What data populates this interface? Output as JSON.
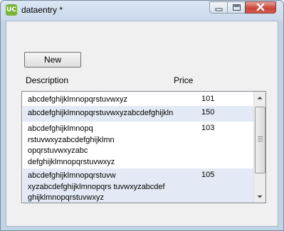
{
  "window": {
    "title": "dataentry *",
    "app_icon": "uc-app-icon",
    "controls": [
      "minimize-icon",
      "maximize-icon",
      "close-icon"
    ]
  },
  "toolbar": {
    "new_label": "New"
  },
  "headers": {
    "description": "Description",
    "price": "Price"
  },
  "rows": [
    {
      "description": "abcdefghijklmnopqrstuvwxyz",
      "price": "101"
    },
    {
      "description": "abcdefghijklmnopqrstuvwxyzabcdefghijkln",
      "price": "150"
    },
    {
      "description": "abcdefghijklmnopq\nrstuvwxyzabcdefghijklmn\nopqrstuvwxyzabc\ndefghijklmnopqrstuvwxyz",
      "price": "103"
    },
    {
      "description": "abcdefghijklmnopqrstuvw\nxyzabcdefghijklmnopqrs tuvwxyzabcdef\nghijklmnopqrstuvwxyz",
      "price": "105"
    }
  ],
  "colors": {
    "alt_row": "#e3eaf5",
    "window_frame": "#cad9eb",
    "close_button": "#c9453a",
    "app_icon": "#7bb43a"
  }
}
